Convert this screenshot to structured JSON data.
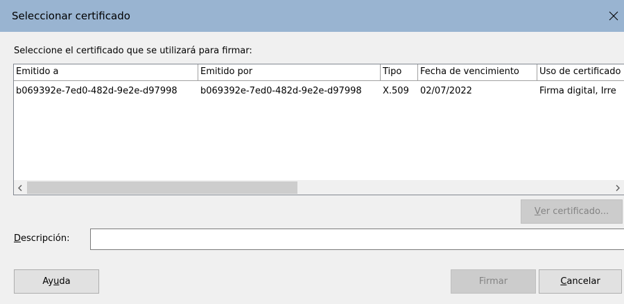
{
  "dialog": {
    "title": "Seleccionar certificado"
  },
  "instruction": "Seleccione el certificado que se utilizará para firmar:",
  "table": {
    "columns": [
      "Emitido a",
      "Emitido por",
      "Tipo",
      "Fecha de vencimiento",
      "Uso de certificado"
    ],
    "rows": [
      [
        "b069392e-7ed0-482d-9e2e-d97998",
        "b069392e-7ed0-482d-9e2e-d97998",
        "X.509",
        "02/07/2022",
        "Firma digital, Irre"
      ]
    ]
  },
  "buttons": {
    "view_certificate": {
      "mnemonic": "V",
      "rest": "er certificado..."
    },
    "help": {
      "before": "Ay",
      "mnemonic": "u",
      "after": "da"
    },
    "sign": "Firmar",
    "cancel": {
      "mnemonic": "C",
      "rest": "ancelar"
    }
  },
  "description": {
    "label_mnemonic": "D",
    "label_rest": "escripción:",
    "value": ""
  },
  "colors": {
    "titlebar": "#99b4d1",
    "dialog_bg": "#f0f0f0",
    "disabled_text": "#838383"
  },
  "icons": {
    "close": "close-icon",
    "scroll_left": "chevron-left-icon",
    "scroll_right": "chevron-right-icon"
  }
}
